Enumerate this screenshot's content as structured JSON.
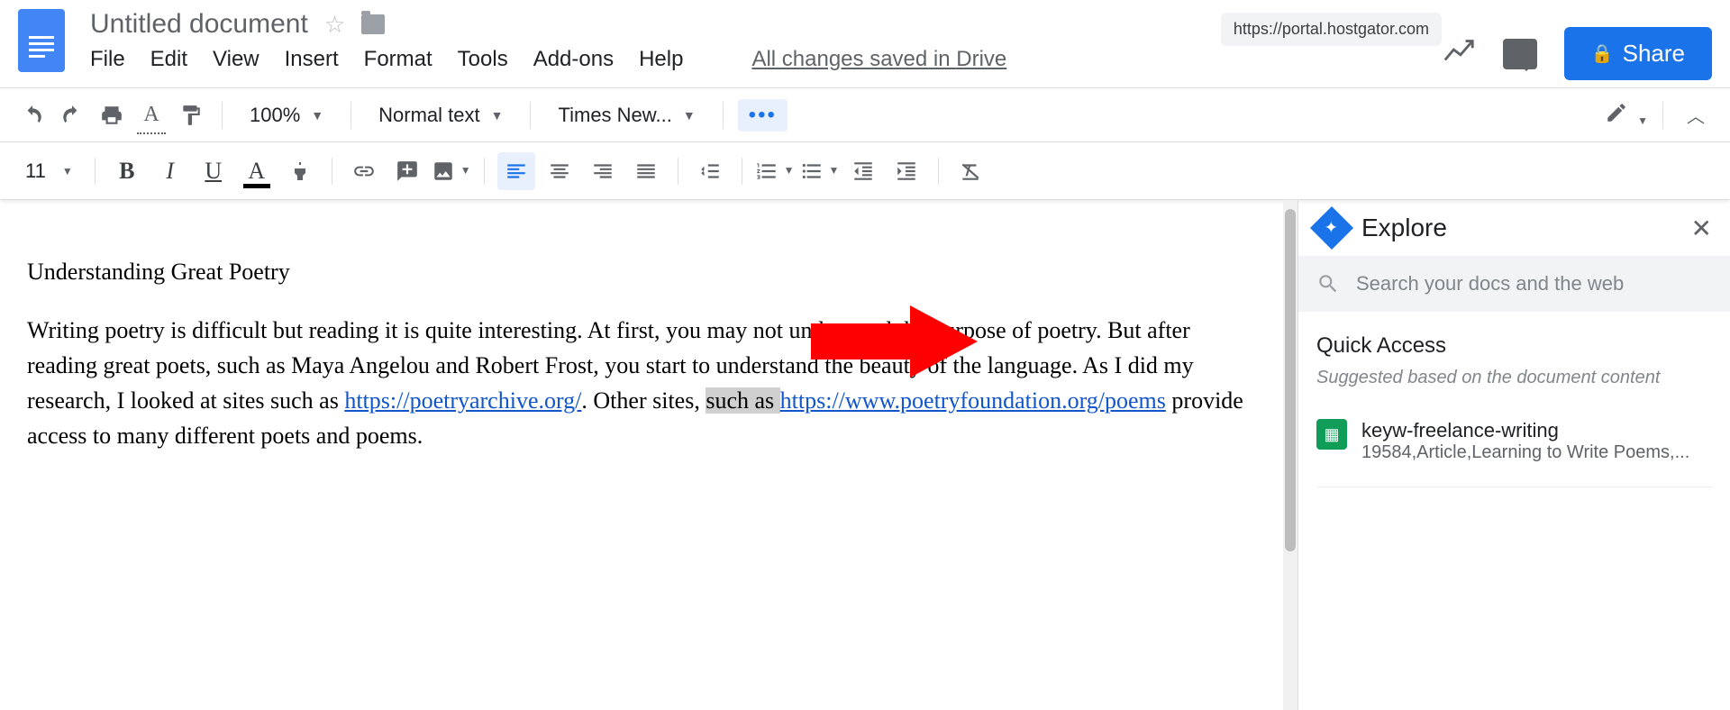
{
  "header": {
    "title": "Untitled document",
    "url_badge": "https://portal.hostgator.com",
    "share_label": "Share",
    "menus": [
      "File",
      "Edit",
      "View",
      "Insert",
      "Format",
      "Tools",
      "Add-ons",
      "Help"
    ],
    "save_status": "All changes saved in Drive"
  },
  "toolbar1": {
    "zoom": "100%",
    "style": "Normal text",
    "font": "Times New..."
  },
  "toolbar2": {
    "font_size": "11"
  },
  "document": {
    "heading": "Understanding Great Poetry",
    "para_a": "Writing poetry is difficult but reading it is quite interesting. At first, you may not understand the purpose of poetry. But after reading great poets, such as Maya Angelou and Robert Frost, you start to understand the beauty of the language. As I did my research, I looked at sites such as ",
    "link1_text": "https://poetryarchive.org/",
    "para_b": ". Other sites, ",
    "sel_text": "such as ",
    "link2_text": "https://www.poetryfoundation.org/poems",
    "para_c": " provide access to many different poets and poems."
  },
  "explore": {
    "title": "Explore",
    "search_placeholder": "Search your docs and the web",
    "quick_access_title": "Quick Access",
    "quick_access_sub": "Suggested based on the document content",
    "item": {
      "name": "keyw-freelance-writing",
      "detail": "19584,Article,Learning to Write Poems,..."
    }
  }
}
